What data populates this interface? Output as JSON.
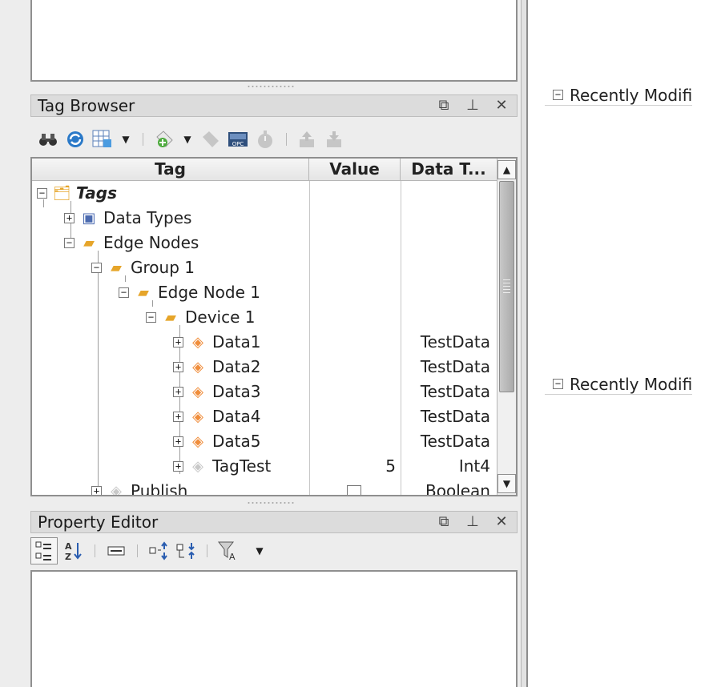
{
  "tag_browser": {
    "title": "Tag Browser",
    "columns": [
      "Tag",
      "Value",
      "Data T..."
    ],
    "rows": [
      {
        "name": "Tags",
        "value": "",
        "type": "",
        "icon": "tags-folder-icon",
        "expander": "−"
      },
      {
        "name": "Data Types",
        "value": "",
        "type": "",
        "icon": "data-types-folder-icon",
        "expander": "+"
      },
      {
        "name": "Edge Nodes",
        "value": "",
        "type": "",
        "icon": "folder-icon",
        "expander": "−"
      },
      {
        "name": "Group 1",
        "value": "",
        "type": "",
        "icon": "folder-icon",
        "expander": "−"
      },
      {
        "name": "Edge Node 1",
        "value": "",
        "type": "",
        "icon": "folder-icon",
        "expander": "−"
      },
      {
        "name": "Device 1",
        "value": "",
        "type": "",
        "icon": "folder-icon",
        "expander": "−"
      },
      {
        "name": "Data1",
        "value": "",
        "type": "TestData",
        "icon": "udt-tag-icon",
        "expander": "+"
      },
      {
        "name": "Data2",
        "value": "",
        "type": "TestData",
        "icon": "udt-tag-icon",
        "expander": "+"
      },
      {
        "name": "Data3",
        "value": "",
        "type": "TestData",
        "icon": "udt-tag-icon",
        "expander": "+"
      },
      {
        "name": "Data4",
        "value": "",
        "type": "TestData",
        "icon": "udt-tag-icon",
        "expander": "+"
      },
      {
        "name": "Data5",
        "value": "",
        "type": "TestData",
        "icon": "udt-tag-icon",
        "expander": "+"
      },
      {
        "name": "TagTest",
        "value": "5",
        "type": "Int4",
        "icon": "tag-icon",
        "expander": "+"
      },
      {
        "name": "Publish",
        "value": "",
        "type": "Boolean",
        "icon": "tag-icon",
        "expander": "+"
      }
    ]
  },
  "property_editor": {
    "title": "Property Editor"
  },
  "right_panel": {
    "section_1": "Recently Modifi",
    "section_2": "Recently Modifi"
  },
  "window_controls": {
    "float": "⧉",
    "pin": "⊥",
    "close": "✕"
  },
  "colors": {
    "titlebar_bg": "#dcdcdc",
    "folder": "#e6a52a",
    "udt_tag": "#f08d3b"
  }
}
